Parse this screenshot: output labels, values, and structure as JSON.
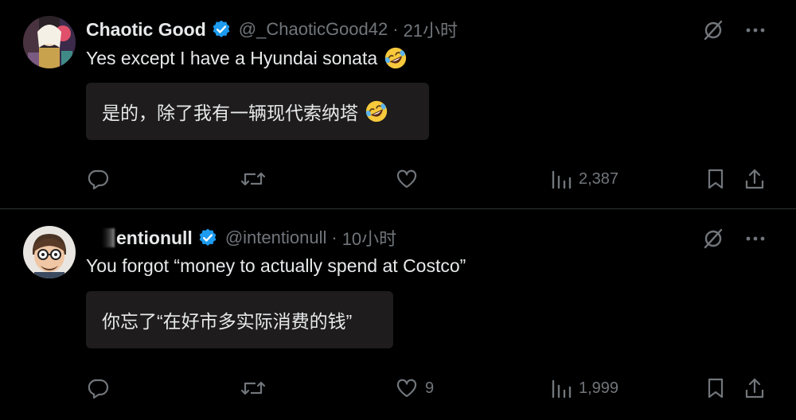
{
  "tweets": [
    {
      "display_name": "Chaotic Good",
      "handle": "@_ChaoticGood42",
      "separator": "·",
      "time": "21小时",
      "text": "Yes except I have a Hyundai sonata",
      "translation": "是的，除了我有一辆现代索纳塔",
      "metrics": {
        "replies": "",
        "reposts": "",
        "likes": "",
        "views": "2,387"
      }
    },
    {
      "display_name": "entionull",
      "handle": "@intentionull",
      "separator": "·",
      "time": "10小时",
      "text": "You forgot “money to actually spend at Costco”",
      "translation": "你忘了“在好市多实际消费的钱”",
      "metrics": {
        "replies": "",
        "reposts": "",
        "likes": "9",
        "views": "1,999"
      }
    }
  ],
  "icons": {
    "verified": "verified-badge-icon",
    "grok": "grok-icon",
    "more": "more-icon",
    "reply": "reply-icon",
    "repost": "repost-icon",
    "like": "heart-icon",
    "views": "views-icon",
    "bookmark": "bookmark-icon",
    "share": "share-icon",
    "emoji": "rolling-on-floor-laughing-emoji"
  },
  "colors": {
    "background": "#000000",
    "text": "#e7e9ea",
    "muted": "#71767b",
    "verified": "#1d9bf0",
    "translation_bg": "#1e1c1c",
    "divider": "#2f3336"
  }
}
